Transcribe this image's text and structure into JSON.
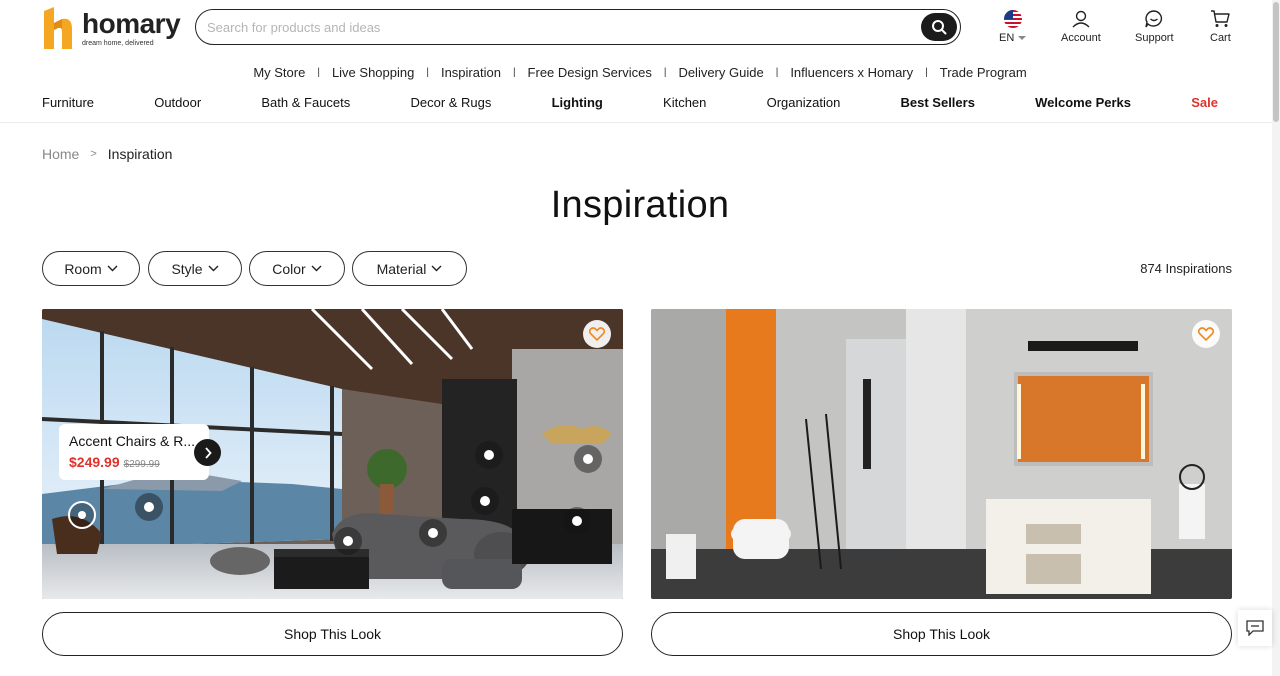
{
  "brand": {
    "name": "homary",
    "tagline": "dream home, delivered",
    "accent": "#f5a623"
  },
  "search": {
    "placeholder": "Search for products and ideas"
  },
  "header": {
    "language": "EN",
    "account": "Account",
    "support": "Support",
    "cart": "Cart"
  },
  "subnav": [
    "My Store",
    "Live Shopping",
    "Inspiration",
    "Free Design Services",
    "Delivery Guide",
    "Influencers x Homary",
    "Trade Program"
  ],
  "categories": [
    {
      "label": "Furniture"
    },
    {
      "label": "Outdoor"
    },
    {
      "label": "Bath & Faucets"
    },
    {
      "label": "Decor & Rugs"
    },
    {
      "label": "Lighting"
    },
    {
      "label": "Kitchen"
    },
    {
      "label": "Organization"
    },
    {
      "label": "Best Sellers"
    },
    {
      "label": "Welcome Perks"
    },
    {
      "label": "Sale"
    }
  ],
  "breadcrumb": {
    "home": "Home",
    "separator": ">",
    "current": "Inspiration"
  },
  "page_title": "Inspiration",
  "filters": [
    "Room",
    "Style",
    "Color",
    "Material"
  ],
  "count": "874 Inspirations",
  "cards": [
    {
      "tooltip": {
        "name": "Accent Chairs & R...",
        "price": "$249.99",
        "was": "$299.99"
      },
      "cta": "Shop This Look"
    },
    {
      "cta": "Shop This Look"
    }
  ],
  "colors": {
    "sale": "#e0322b",
    "heart": "#f08a24"
  }
}
